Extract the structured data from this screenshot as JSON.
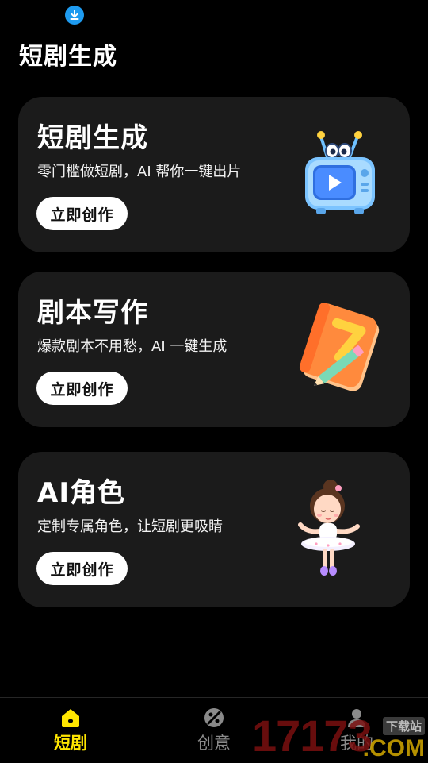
{
  "status_bar": {
    "download_icon": "download-circle-icon"
  },
  "page_title": "短剧生成",
  "cards": [
    {
      "title": "短剧生成",
      "description": "零门槛做短剧，AI 帮你一键出片",
      "button_label": "立即创作",
      "art_icon": "tv-icon"
    },
    {
      "title": "剧本写作",
      "description": "爆款剧本不用愁，AI 一键生成",
      "button_label": "立即创作",
      "art_icon": "notebook-pencil-icon"
    },
    {
      "title": "AI角色",
      "description": "定制专属角色，让短剧更吸睛",
      "button_label": "立即创作",
      "art_icon": "ballerina-character-icon"
    }
  ],
  "tabbar": {
    "tabs": [
      {
        "label": "短剧",
        "icon": "home-icon",
        "active": true
      },
      {
        "label": "创意",
        "icon": "creative-icon",
        "active": false
      },
      {
        "label": "我的",
        "icon": "profile-icon",
        "active": false
      }
    ]
  },
  "watermark": {
    "digits": "17173",
    "site_label": "下载站",
    "domain_suffix": ".COM"
  },
  "colors": {
    "background": "#000000",
    "card_bg": "#1b1b1b",
    "active_tab": "#ffe600",
    "inactive_tab": "#8a8a8a",
    "status_icon": "#1e9bf0"
  }
}
